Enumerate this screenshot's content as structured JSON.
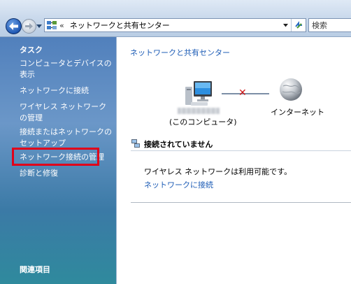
{
  "toolbar": {
    "breadcrumb_separator": "«",
    "address_text": "ネットワークと共有センター",
    "search_placeholder": "検索"
  },
  "sidebar": {
    "tasks_heading": "タスク",
    "items": [
      {
        "label": "コンピュータとデバイスの表示"
      },
      {
        "label": "ネットワークに接続"
      },
      {
        "label": "ワイヤレス ネットワークの管理"
      },
      {
        "label": "接続またはネットワークのセットアップ"
      },
      {
        "label": "ネットワーク接続の管理"
      },
      {
        "label": "診断と修復"
      }
    ],
    "related_heading": "関連項目"
  },
  "main": {
    "title": "ネットワークと共有センター",
    "computer_label": "(このコンピュータ)",
    "internet_label": "インターネット",
    "status_text": "接続されていません",
    "wireless_available": "ワイヤレス ネットワークは利用可能です。",
    "connect_link": "ネットワークに接続"
  },
  "icons": {
    "back": "back-arrow-icon",
    "forward": "forward-arrow-icon",
    "network_center": "network-center-icon",
    "refresh": "refresh-icon",
    "computer": "computer-icon",
    "globe": "globe-icon",
    "disconnected": "disconnected-x-icon",
    "status": "network-status-icon"
  },
  "colors": {
    "link": "#1d5cb6",
    "highlight": "#e0001a",
    "disconnected": "#d01818"
  }
}
